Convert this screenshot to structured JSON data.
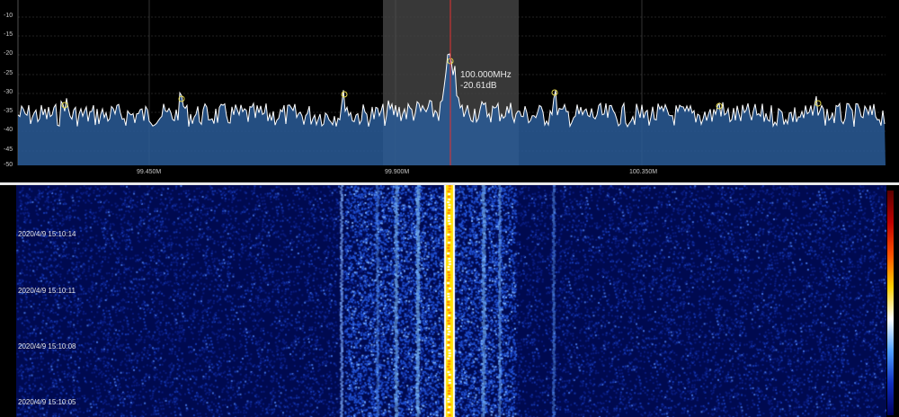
{
  "spectrum": {
    "y_ticks": [
      "-10",
      "-15",
      "-20",
      "-25",
      "-30",
      "-35",
      "-40",
      "-45",
      "-50"
    ],
    "x_ticks": [
      "99.450M",
      "99.900M",
      "100.350M"
    ],
    "marker": {
      "freq": "100.000MHz",
      "level": "-20.61dB"
    },
    "colors": {
      "trace": "#ffffff",
      "fill": "#2a5c98",
      "marker": "#e53030",
      "peak_circle": "#e6d84a",
      "selection": "#ffffff"
    }
  },
  "waterfall": {
    "timestamps": [
      "2020/4/9 15:10:14",
      "2020/4/9 15:10:11",
      "2020/4/9 15:10:08",
      "2020/4/9 15:10:05"
    ],
    "colormap": [
      "#5a0000",
      "#c00000",
      "#ff5000",
      "#ffd000",
      "#ffffff",
      "#50a0ff",
      "#1030c0",
      "#000060"
    ]
  }
}
